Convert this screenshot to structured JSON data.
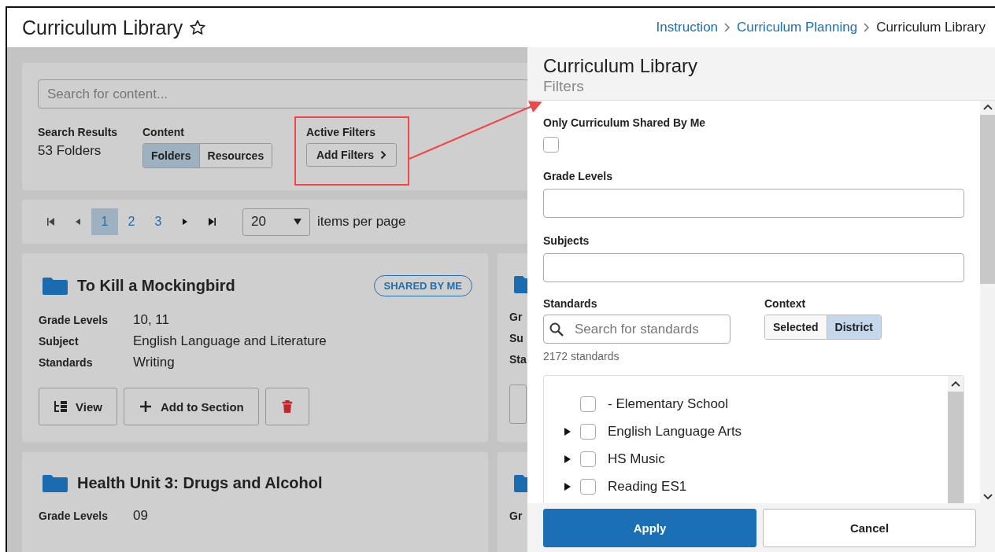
{
  "page": {
    "title": "Curriculum Library",
    "favorite": false
  },
  "breadcrumb": [
    {
      "label": "Instruction",
      "link": true
    },
    {
      "label": "Curriculum Planning",
      "link": true
    },
    {
      "label": "Curriculum Library",
      "link": false
    }
  ],
  "search": {
    "placeholder": "Search for content..."
  },
  "results": {
    "label": "Search Results",
    "value": "53 Folders"
  },
  "content_toggle": {
    "label": "Content",
    "options": [
      {
        "label": "Folders",
        "selected": true
      },
      {
        "label": "Resources",
        "selected": false
      }
    ]
  },
  "active_filters": {
    "label": "Active Filters",
    "button": "Add Filters"
  },
  "pagination": {
    "pages": [
      {
        "label": "1",
        "selected": true
      },
      {
        "label": "2",
        "selected": false
      },
      {
        "label": "3",
        "selected": false
      }
    ],
    "page_size": "20",
    "page_size_label": "items per page"
  },
  "cards": [
    {
      "title": "To Kill a Mockingbird",
      "badge": "SHARED BY ME",
      "fields": [
        {
          "label": "Grade Levels",
          "value": "10, 11"
        },
        {
          "label": "Subject",
          "value": "English Language and Literature"
        },
        {
          "label": "Standards",
          "value": "Writing"
        }
      ],
      "actions": [
        {
          "kind": "view",
          "label": "View"
        },
        {
          "kind": "add",
          "label": "Add to Section"
        },
        {
          "kind": "delete"
        }
      ]
    },
    {
      "title": "Health Unit 3: Drugs and Alcohol",
      "fields": [
        {
          "label": "Grade Levels",
          "value": "09"
        }
      ]
    }
  ],
  "cards_column_2": [
    {
      "labels": [
        "Gr",
        "Su",
        "Sta"
      ],
      "has_actions": true
    },
    {
      "labels": [
        "Gr"
      ],
      "has_actions": false
    }
  ],
  "panel": {
    "title": "Curriculum Library",
    "subtitle": "Filters",
    "shared_only": {
      "label": "Only Curriculum Shared By Me",
      "checked": false
    },
    "grade_levels": {
      "label": "Grade Levels"
    },
    "subjects": {
      "label": "Subjects"
    },
    "standards": {
      "label": "Standards",
      "placeholder": "Search for standards",
      "count": "2172 standards"
    },
    "context": {
      "label": "Context",
      "options": [
        {
          "label": "Selected",
          "selected": false
        },
        {
          "label": "District",
          "selected": true
        }
      ]
    },
    "tree": [
      {
        "label": "- Elementary School",
        "has_children": false,
        "checked": false
      },
      {
        "label": "English Language Arts",
        "has_children": true,
        "checked": false
      },
      {
        "label": "HS Music",
        "has_children": true,
        "checked": false
      },
      {
        "label": "Reading ES1",
        "has_children": true,
        "checked": false
      }
    ],
    "buttons": [
      {
        "kind": "primary",
        "label": "Apply"
      },
      {
        "kind": "secondary",
        "label": "Cancel"
      }
    ]
  }
}
